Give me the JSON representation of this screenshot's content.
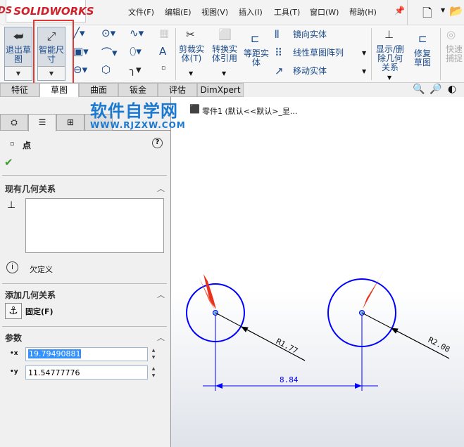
{
  "app": {
    "logo": "SOLIDWORKS"
  },
  "menu": [
    "文件(F)",
    "编辑(E)",
    "视图(V)",
    "插入(I)",
    "工具(T)",
    "窗口(W)",
    "帮助(H)"
  ],
  "ribbon": {
    "exit_sketch": "退出草图",
    "smart_dimension": "智能尺寸",
    "trim": "剪裁实体(T)",
    "convert": "转换实体引用",
    "offset": "等距实体",
    "mirror": "镜向实体",
    "linear_pattern": "线性草图阵列",
    "move": "移动实体",
    "show_delete_relations": "显示/删除几何关系",
    "repair": "修复草图",
    "quick_snap": "快速捕捉"
  },
  "tabs": [
    "特征",
    "草图",
    "曲面",
    "钣金",
    "评估",
    "DimXpert"
  ],
  "watermark": {
    "title": "软件自学网",
    "url": "WWW.RJZXW.COM"
  },
  "breadcrumb": "零件1  (默认<<默认>_显...",
  "panel": {
    "title": "点",
    "existing_relations": "现有几何关系",
    "status": "欠定义",
    "add_relations": "添加几何关系",
    "fix": "固定(F)",
    "parameters": "参数",
    "x_value": "19.79490881",
    "y_value": "11.54777776"
  },
  "sketch": {
    "radius1": "R1.77",
    "radius2": "R2.08",
    "distance": "8.84"
  },
  "colors": {
    "sketch": "#0000ff",
    "arrow": "#e8321e",
    "highlight": "#e53935"
  }
}
